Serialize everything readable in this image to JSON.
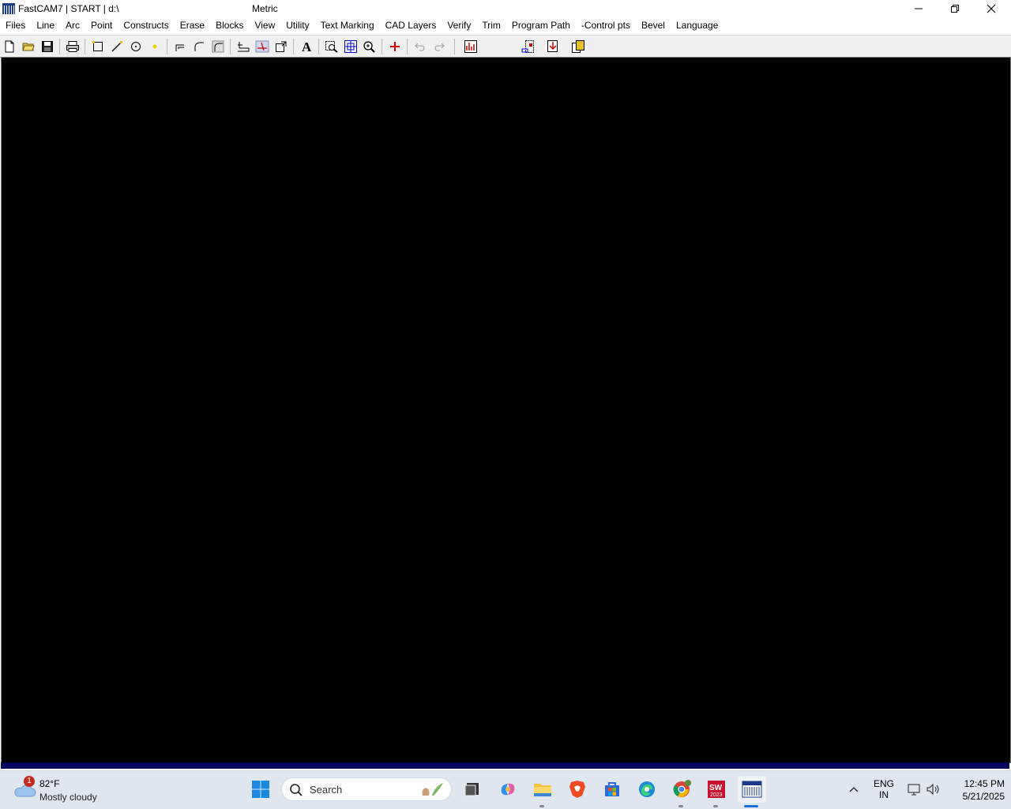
{
  "window": {
    "title": "FastCAM7  |  START  |  d:\\",
    "center_title": "Metric"
  },
  "menu": [
    "Files",
    "Line",
    "Arc",
    "Point",
    "Constructs",
    "Erase",
    "Blocks",
    "View",
    "Utility",
    "Text Marking",
    "CAD Layers",
    "Verify",
    "Trim",
    "Program Path",
    "-Control pts",
    "Bevel",
    "Language"
  ],
  "toolbar_icons": [
    "new-file-icon",
    "open-folder-icon",
    "save-icon",
    "print-icon",
    "rectangle-icon",
    "line-icon",
    "circle-icon",
    "point-icon",
    "corner-icon",
    "fillet-icon",
    "arc-corner-icon",
    "path-icon",
    "break-icon",
    "export-icon",
    "text-icon",
    "zoom-window-icon",
    "zoom-all-icon",
    "zoom-icon",
    "origin-icon",
    "undo-icon",
    "redo-icon",
    "chart-icon",
    "nest-icon",
    "download-icon",
    "copy-icon"
  ],
  "colors": {
    "canvas": "#000000",
    "status_strip": "#04045c",
    "taskbar": "#dfe6ef"
  },
  "taskbar": {
    "weather_badge": "1",
    "temperature": "82°F",
    "condition": "Mostly cloudy",
    "search_placeholder": "Search",
    "language_line1": "ENG",
    "language_line2": "IN",
    "time": "12:45 PM",
    "date": "5/21/2025"
  }
}
